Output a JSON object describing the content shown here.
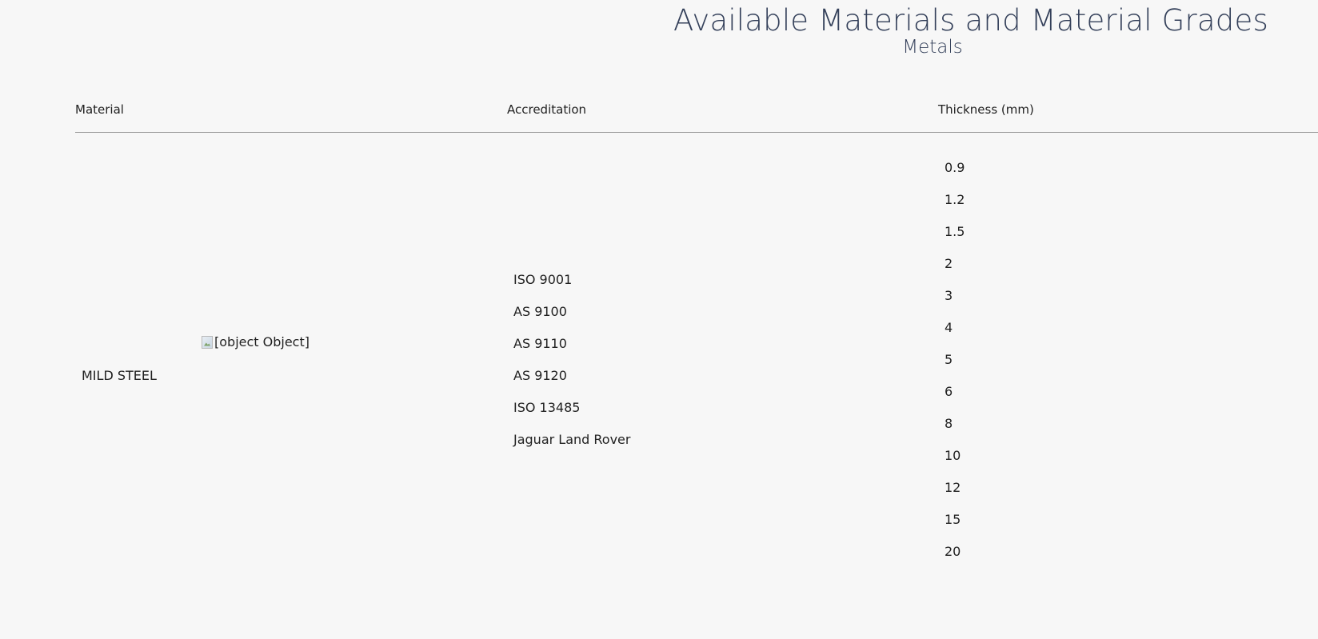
{
  "header": {
    "title": "Available Materials and Material Grades",
    "subtitle": "Metals"
  },
  "table": {
    "columns": [
      "Material",
      "Accreditation",
      "Thickness (mm)"
    ],
    "rows": [
      {
        "material": "MILD STEEL",
        "image_alt": "[object Object]",
        "accreditations": [
          "ISO 9001",
          "AS 9100",
          "AS 9110",
          "AS 9120",
          "ISO 13485",
          "Jaguar Land Rover"
        ],
        "thicknesses": [
          "0.9",
          "1.2",
          "1.5",
          "2",
          "3",
          "4",
          "5",
          "6",
          "8",
          "10",
          "12",
          "15",
          "20"
        ]
      }
    ]
  }
}
